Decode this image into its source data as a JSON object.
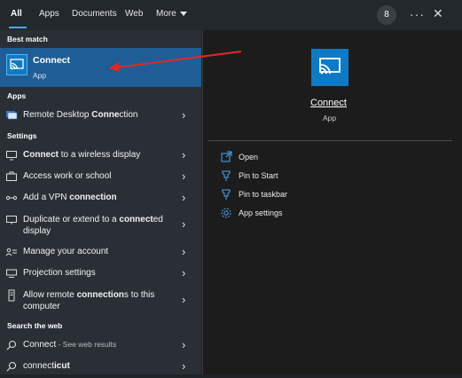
{
  "tabs": [
    {
      "label": "All",
      "active": true
    },
    {
      "label": "Apps"
    },
    {
      "label": "Documents"
    },
    {
      "label": "Web"
    },
    {
      "label": "More"
    }
  ],
  "account_badge": "8",
  "more_options": "···",
  "close": "✕",
  "left_panel": {
    "best_match_label": "Best match",
    "best_match": {
      "title": "Connect",
      "subtitle": "App",
      "icon": "connect-app-icon"
    },
    "apps_label": "Apps",
    "apps": [
      {
        "label_prefix": "Remote Desktop ",
        "label_bold": "Conne",
        "label_suffix": "ction",
        "icon": "remote-desktop-icon"
      }
    ],
    "settings_label": "Settings",
    "settings": [
      {
        "label_bold": "Connect",
        "label_suffix": " to a wireless display",
        "icon": "display-icon"
      },
      {
        "label": "Access work or school",
        "icon": "briefcase-icon"
      },
      {
        "label_prefix": "Add a VPN ",
        "label_bold": "connection",
        "icon": "vpn-icon"
      },
      {
        "label_prefix": "Duplicate or extend to a ",
        "label_bold": "connect",
        "label_suffix": "ed",
        "line2": "display",
        "icon": "monitor-icon"
      },
      {
        "label": "Manage your account",
        "icon": "account-icon"
      },
      {
        "label": "Projection settings",
        "icon": "projection-icon"
      },
      {
        "label_prefix": "Allow remote ",
        "label_bold": "connection",
        "label_suffix": "s to this",
        "line2": "computer",
        "icon": "remote-icon"
      }
    ],
    "web_label": "Search the web",
    "web": [
      {
        "label": "Connect",
        "sub": " - See web results",
        "icon": "search-icon"
      },
      {
        "label_prefix": "connect",
        "label_bold": "icut",
        "icon": "search-icon"
      }
    ]
  },
  "right_panel": {
    "title": "Connect",
    "subtitle": "App",
    "actions": [
      {
        "label": "Open",
        "icon": "open-icon"
      },
      {
        "label": "Pin to Start",
        "icon": "pin-icon"
      },
      {
        "label": "Pin to taskbar",
        "icon": "pin-icon"
      },
      {
        "label": "App settings",
        "icon": "gear-icon"
      }
    ]
  },
  "colors": {
    "accent": "#4aa8ff",
    "selected_bg": "#1e5d95",
    "app_tile": "#0f7ac3",
    "annotation_arrow": "#e32626"
  }
}
